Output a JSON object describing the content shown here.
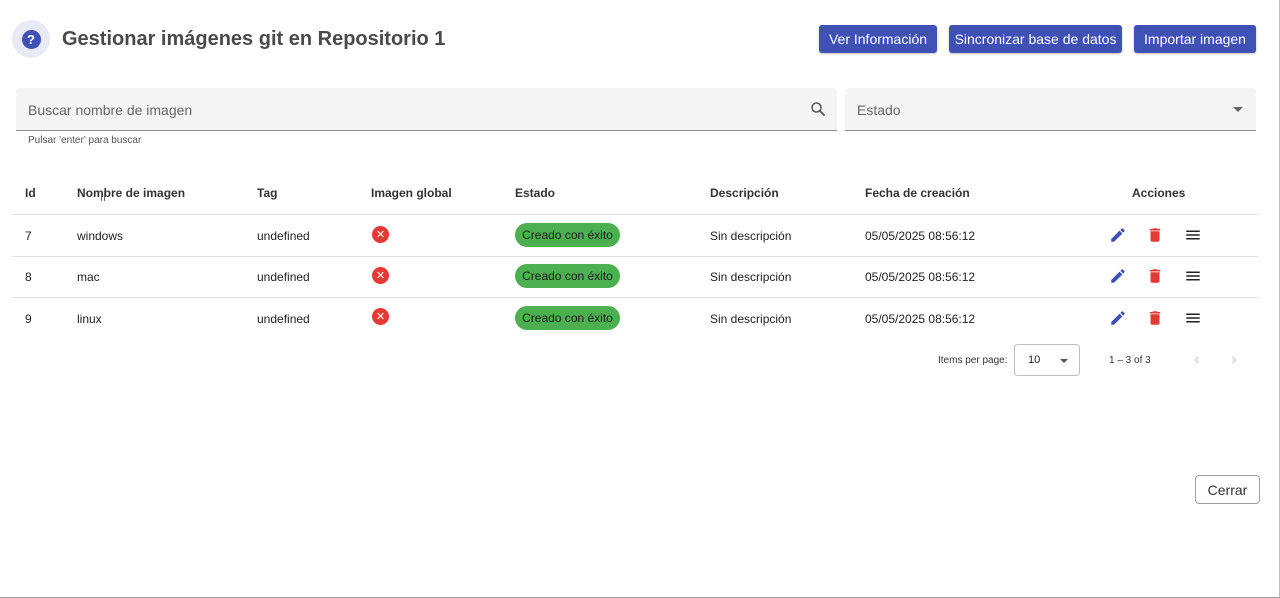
{
  "header": {
    "title": "Gestionar imágenes git en Repositorio 1",
    "buttons": {
      "info": "Ver Información",
      "sync": "Sincronizar base de datos",
      "import": "Importar imagen"
    }
  },
  "filters": {
    "search_placeholder": "Buscar nombre de imagen",
    "search_hint": "Pulsar 'enter' para buscar",
    "status_placeholder": "Estado"
  },
  "table": {
    "columns": [
      "Id",
      "Nombre de imagen",
      "Tag",
      "Imagen global",
      "Estado",
      "Descripción",
      "Fecha de creación",
      "Acciones"
    ],
    "rows": [
      {
        "id": "7",
        "name": "windows",
        "tag": "undefined",
        "global": "false",
        "status": "Creado con éxito",
        "description": "Sin descripción",
        "created": "05/05/2025 08:56:12"
      },
      {
        "id": "8",
        "name": "mac",
        "tag": "undefined",
        "global": "false",
        "status": "Creado con éxito",
        "description": "Sin descripción",
        "created": "05/05/2025 08:56:12"
      },
      {
        "id": "9",
        "name": "linux",
        "tag": "undefined",
        "global": "false",
        "status": "Creado con éxito",
        "description": "Sin descripción",
        "created": "05/05/2025 08:56:12"
      }
    ]
  },
  "paginator": {
    "items_label": "Items per page:",
    "page_size": "10",
    "range": "1 – 3 of 3"
  },
  "footer": {
    "close": "Cerrar"
  },
  "icons": {
    "help": "help-circle-icon",
    "search": "search-icon",
    "edit": "pencil-icon",
    "delete": "trash-icon",
    "menu": "hamburger-menu-icon",
    "global_false": "close-circle-icon"
  },
  "colors": {
    "primary": "#3f51b5",
    "success": "#4caf50",
    "danger": "#e53935"
  }
}
